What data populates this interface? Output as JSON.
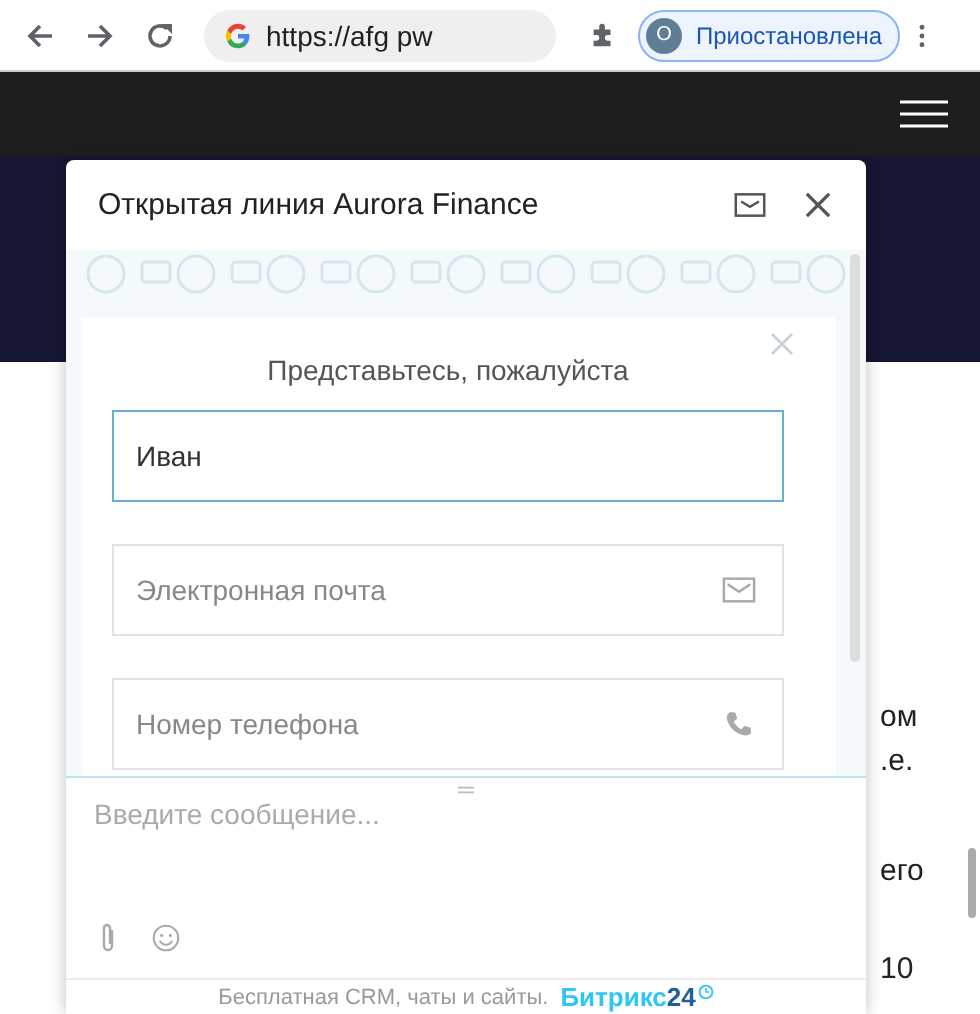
{
  "browser": {
    "url": "https://afg pw",
    "profile": {
      "initial": "О",
      "status": "Приостановлена"
    }
  },
  "page": {
    "text_fragments": [
      "ом",
      ".е.",
      "его",
      "10"
    ]
  },
  "chat": {
    "title": "Открытая линия Aurora Finance",
    "form": {
      "title": "Представьтесь, пожалуйста",
      "fields": [
        {
          "kind": "name",
          "value": "Иван",
          "focused": true
        },
        {
          "kind": "email",
          "placeholder": "Электронная почта",
          "focused": false
        },
        {
          "kind": "phone",
          "placeholder": "Номер телефона",
          "focused": false
        }
      ]
    },
    "message": {
      "placeholder": "Введите сообщение..."
    },
    "footer": {
      "text": "Бесплатная CRM, чаты и сайты.",
      "brand": "Битрикс",
      "brand_number": "24"
    }
  }
}
